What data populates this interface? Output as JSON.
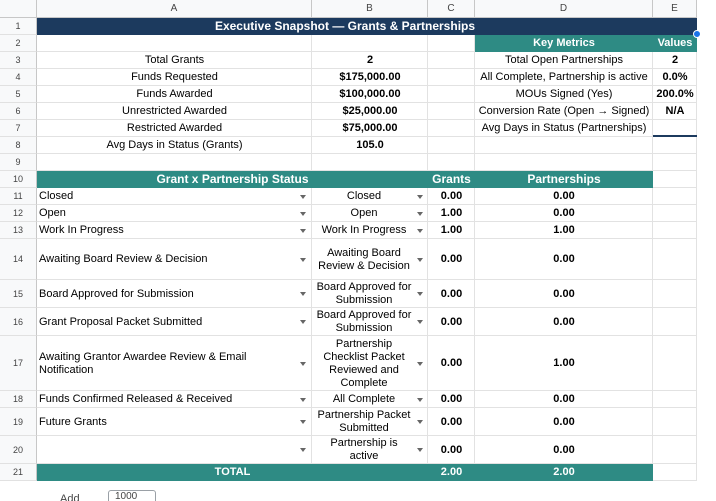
{
  "columns": [
    "A",
    "B",
    "C",
    "D",
    "E"
  ],
  "rows": [
    "1",
    "2",
    "3",
    "4",
    "5",
    "6",
    "7",
    "8",
    "9",
    "10",
    "11",
    "12",
    "13",
    "14",
    "15",
    "16",
    "17",
    "18",
    "19",
    "20",
    "21"
  ],
  "title": "Executive Snapshot — Grants & Partnerships",
  "summary": [
    {
      "label": "Total Grants",
      "value": "2"
    },
    {
      "label": "Funds Requested",
      "value": "$175,000.00"
    },
    {
      "label": "Funds Awarded",
      "value": "$100,000.00"
    },
    {
      "label": "Unrestricted Awarded",
      "value": "$25,000.00"
    },
    {
      "label": "Restricted Awarded",
      "value": "$75,000.00"
    },
    {
      "label": "Avg Days in Status (Grants)",
      "value": "105.0"
    }
  ],
  "key_metrics": {
    "header": "Key Metrics",
    "values_header": "Values",
    "items": [
      {
        "label": "Total Open Partnerships",
        "value": "2"
      },
      {
        "label": "All Complete, Partnership is active",
        "value": "0.0%"
      },
      {
        "label": "MOUs Signed (Yes)",
        "value": "200.0%"
      },
      {
        "label": "Conversion Rate (Open → Signed)",
        "value": "N/A"
      },
      {
        "label": "Avg Days in Status (Partnerships)",
        "value": ""
      }
    ]
  },
  "status_table": {
    "header": "Grant x Partnership Status",
    "grants_header": "Grants",
    "partnerships_header": "Partnerships",
    "rows": [
      {
        "grant_status": "Closed",
        "partnership_status": "Closed",
        "grants": "0.00",
        "partnerships": "0.00"
      },
      {
        "grant_status": "Open",
        "partnership_status": "Open",
        "grants": "1.00",
        "partnerships": "0.00"
      },
      {
        "grant_status": "Work In Progress",
        "partnership_status": "Work In Progress",
        "grants": "1.00",
        "partnerships": "1.00"
      },
      {
        "grant_status": "Awaiting Board Review & Decision",
        "partnership_status": "Awaiting Board Review & Decision",
        "grants": "0.00",
        "partnerships": "0.00"
      },
      {
        "grant_status": "Board Approved for Submission",
        "partnership_status": "Board Approved for Submission",
        "grants": "0.00",
        "partnerships": "0.00"
      },
      {
        "grant_status": "Grant Proposal Packet Submitted",
        "partnership_status": "Board Approved for Submission",
        "grants": "0.00",
        "partnerships": "0.00"
      },
      {
        "grant_status": "Awaiting Grantor Awardee Review & Email Notification",
        "partnership_status": "Partnership Checklist Packet Reviewed and Complete",
        "grants": "0.00",
        "partnerships": "1.00"
      },
      {
        "grant_status": "Funds Confirmed Released & Received",
        "partnership_status": "All Complete",
        "grants": "0.00",
        "partnerships": "0.00"
      },
      {
        "grant_status": "Future Grants",
        "partnership_status": "Partnership Packet Submitted",
        "grants": "0.00",
        "partnerships": "0.00"
      },
      {
        "grant_status": "",
        "partnership_status": "Partnership is active",
        "grants": "0.00",
        "partnerships": "0.00"
      }
    ],
    "total_label": "TOTAL",
    "total_grants": "2.00",
    "total_partnerships": "2.00"
  },
  "footer": {
    "add_label": "Add",
    "rows_value": "1000"
  }
}
